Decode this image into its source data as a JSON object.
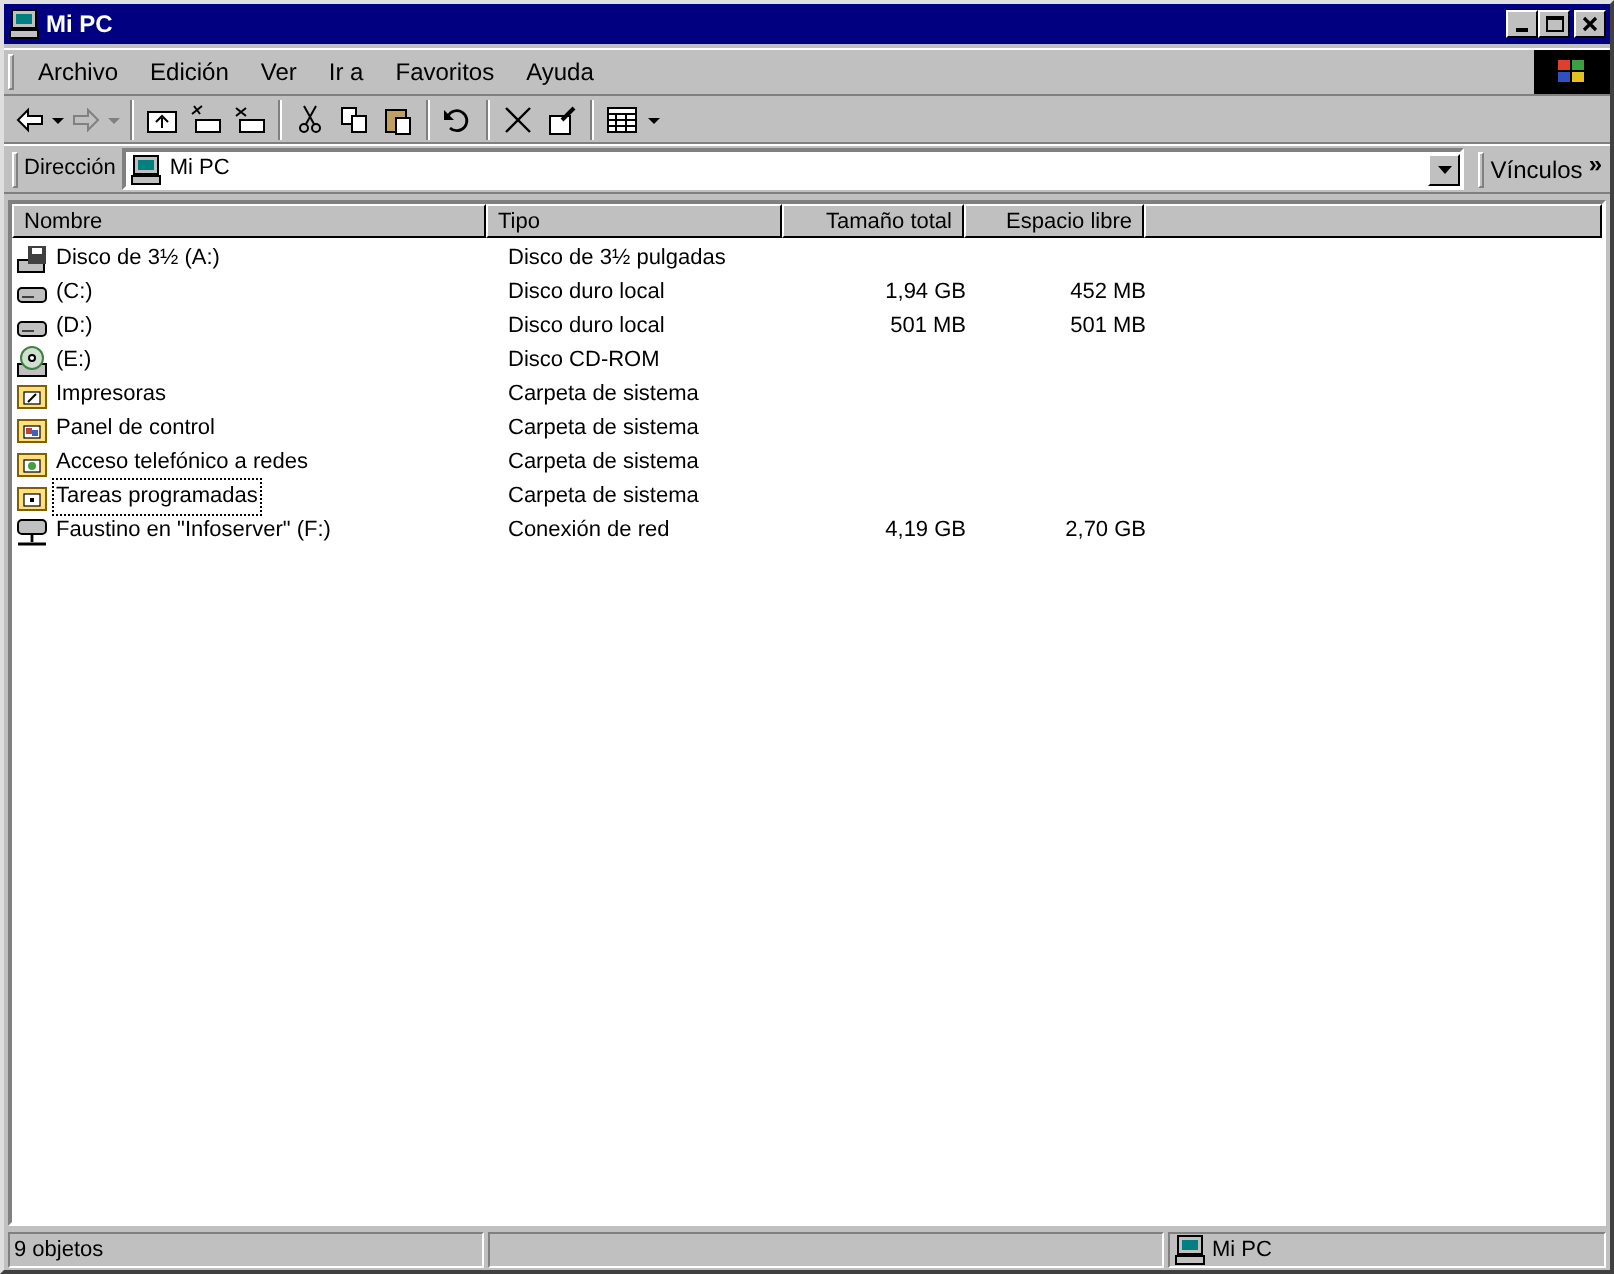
{
  "window": {
    "title": "Mi PC"
  },
  "menu": [
    "Archivo",
    "Edición",
    "Ver",
    "Ir a",
    "Favoritos",
    "Ayuda"
  ],
  "toolbar": [
    [
      {
        "kind": "back",
        "disabled": false
      },
      {
        "kind": "dropdown",
        "disabled": false
      },
      {
        "kind": "forward",
        "disabled": true
      },
      {
        "kind": "dropdown",
        "disabled": true
      }
    ],
    [
      {
        "kind": "up",
        "disabled": false
      },
      {
        "kind": "mapdrive",
        "disabled": false
      },
      {
        "kind": "disconnect",
        "disabled": false
      }
    ],
    [
      {
        "kind": "cut",
        "disabled": false
      },
      {
        "kind": "copy",
        "disabled": false
      },
      {
        "kind": "paste",
        "disabled": false
      }
    ],
    [
      {
        "kind": "undo",
        "disabled": false
      }
    ],
    [
      {
        "kind": "delete",
        "disabled": false
      },
      {
        "kind": "properties",
        "disabled": false
      }
    ],
    [
      {
        "kind": "views",
        "disabled": false
      },
      {
        "kind": "dropdown",
        "disabled": false
      }
    ]
  ],
  "address_bar": {
    "label": "Dirección",
    "value": "Mi PC",
    "links": "Vínculos",
    "more": "»"
  },
  "table": {
    "columns": [
      "Nombre",
      "Tipo",
      "Tamaño total",
      "Espacio libre"
    ],
    "rows": [
      {
        "kind": "floppy",
        "name": "Disco de 3½ (A:)",
        "type": "Disco de 3½ pulgadas",
        "focused": false
      },
      {
        "kind": "hdd",
        "name": "(C:)",
        "type": "Disco duro local",
        "total": "1,94 GB",
        "free": "452 MB",
        "focused": false
      },
      {
        "kind": "hdd",
        "name": "(D:)",
        "type": "Disco duro local",
        "total": "501 MB",
        "free": "501 MB",
        "focused": false
      },
      {
        "kind": "cdrom",
        "name": "(E:)",
        "type": "Disco CD-ROM",
        "focused": false
      },
      {
        "kind": "printers",
        "name": "Impresoras",
        "type": "Carpeta de sistema",
        "focused": false
      },
      {
        "kind": "control",
        "name": "Panel de control",
        "type": "Carpeta de sistema",
        "focused": false
      },
      {
        "kind": "dialup",
        "name": "Acceso telefónico a redes",
        "type": "Carpeta de sistema",
        "focused": false
      },
      {
        "kind": "tasks",
        "name": "Tareas programadas",
        "type": "Carpeta de sistema",
        "focused": true
      },
      {
        "kind": "netdrive",
        "name": "Faustino en \"Infoserver\" (F:)",
        "type": "Conexión de red",
        "total": "4,19 GB",
        "free": "2,70 GB",
        "focused": false
      }
    ]
  },
  "status_bar": {
    "count": "9 objetos",
    "zone": "Mi PC"
  }
}
